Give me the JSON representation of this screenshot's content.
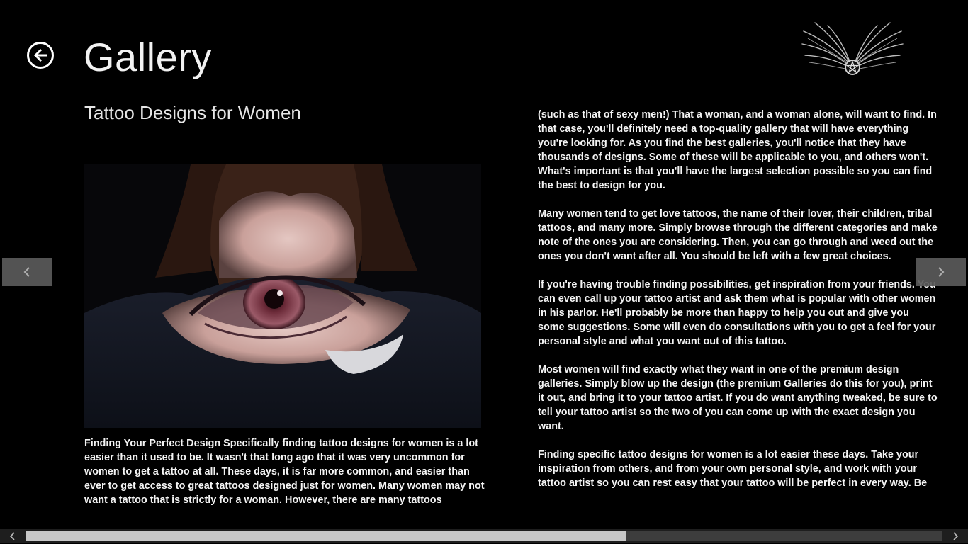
{
  "header": {
    "title": "Gallery",
    "back_icon": "back-arrow-icon",
    "logo_icon": "winged-pentagram-logo"
  },
  "content": {
    "subtitle": "Tattoo Designs for Women",
    "image_alt": "eye tattoo on upper back",
    "column1_text": "Finding Your Perfect Design Specifically finding tattoo designs for women is a lot easier than it used to be. It wasn't that long ago that it was very uncommon for women to get a tattoo at all. These days, it is far more common, and easier than ever to get access to great tattoos designed just for women. Many women may not want a tattoo that is strictly for a woman. However, there are many tattoos",
    "column2_text": "(such as that of sexy men!) That a woman, and a woman alone, will want to find. In that case, you'll definitely need a top-quality gallery that will have everything you're looking for. As you find the best galleries, you'll notice that they have thousands of designs. Some of these will be applicable to you, and others won't. What's important is that you'll have the largest selection possible so you can find the best to design for you.\n\nMany women tend to get love tattoos, the name of their lover, their children, tribal tattoos, and many more. Simply browse through the different categories and make note of the ones you are considering. Then, you can go through and weed out the ones you don't want after all. You should be left with a few great choices.\n\nIf you're having trouble finding possibilities, get inspiration from your friends. You can even call up your tattoo artist and ask them what is popular with other women in his parlor. He'll probably be more than happy to help you out and give you some suggestions. Some will even do consultations with you to get a feel for your personal style and what you want out of this tattoo.\n\nMost women will find exactly what they want in one of the premium design galleries. Simply blow up the design (the premium Galleries do this for you), print it out, and bring it to your tattoo artist. If you do want anything tweaked, be sure to tell your tattoo artist so the two of you can come up with the exact design you want.\n\nFinding specific tattoo designs for women is a lot easier these days. Take your inspiration from others, and from your own personal style, and work with your tattoo artist so you can rest easy that your tattoo will be perfect in every way. Be"
  },
  "navigation": {
    "prev_icon": "chevron-left-icon",
    "next_icon": "chevron-right-icon"
  },
  "scrollbar": {
    "position_fraction": 0.0,
    "visible_fraction": 0.65
  },
  "colors": {
    "background": "#000000",
    "text": "#ffffff",
    "flip_button": "#5b5b5b",
    "scroll_thumb": "#c8c8c8"
  }
}
